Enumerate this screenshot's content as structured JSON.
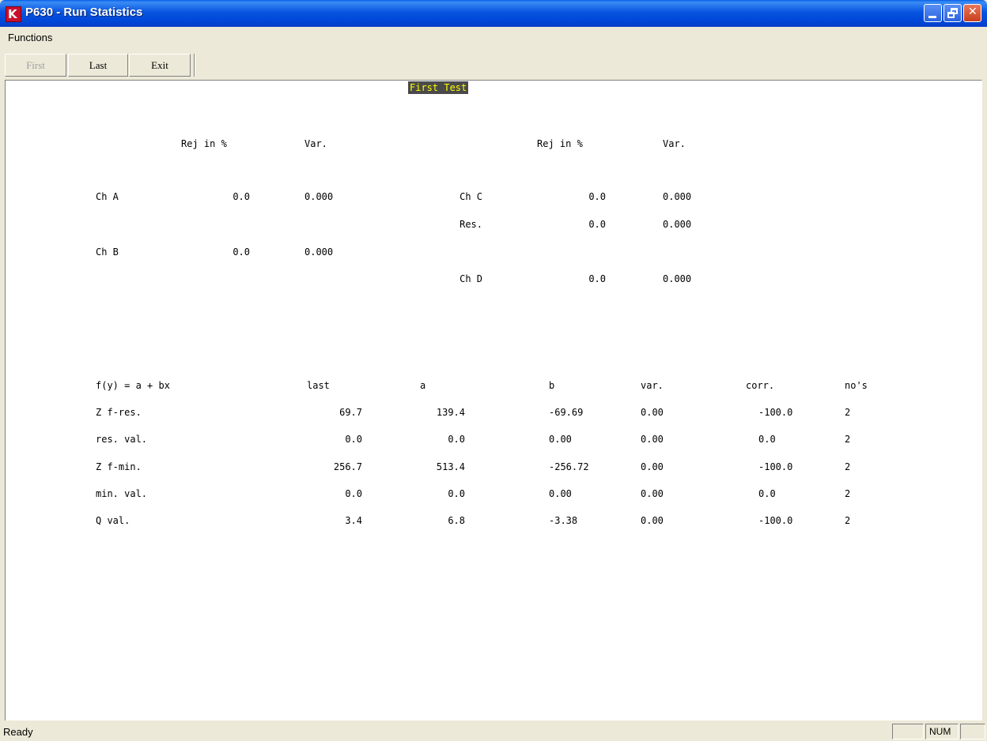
{
  "window": {
    "title": "P630 - Run Statistics",
    "app_icon": "K",
    "controls": {
      "minimize": "minimize-icon",
      "restore": "restore-icon",
      "close": "close-icon"
    }
  },
  "menu": [
    "Functions"
  ],
  "toolbar": {
    "first": "First",
    "last": "Last",
    "exit": "Exit"
  },
  "banner": "First Test",
  "rejection": {
    "headers": {
      "rej": "Rej in %",
      "var": "Var."
    },
    "left": [
      {
        "label": "Ch A",
        "rej": "0.0",
        "var": "0.000"
      },
      {
        "label": "Ch B",
        "rej": "0.0",
        "var": "0.000"
      }
    ],
    "right": [
      {
        "label": "Ch C",
        "rej": "0.0",
        "var": "0.000"
      },
      {
        "label": "Res.",
        "rej": "0.0",
        "var": "0.000"
      },
      {
        "label": "Ch D",
        "rej": "0.0",
        "var": "0.000"
      }
    ]
  },
  "regression": {
    "headers": [
      "f(y) = a + bx",
      "last",
      "a",
      "b",
      "var.",
      "corr.",
      "no's"
    ],
    "rows": [
      [
        "Z f-res.",
        "69.7",
        "139.4",
        "-69.69",
        "0.00",
        "-100.0",
        "2"
      ],
      [
        "res. val.",
        "0.0",
        "0.0",
        "0.00",
        "0.00",
        "0.0",
        "2"
      ],
      [
        "Z f-min.",
        "256.7",
        "513.4",
        "-256.72",
        "0.00",
        "-100.0",
        "2"
      ],
      [
        "min. val.",
        "0.0",
        "0.0",
        "0.00",
        "0.00",
        "0.0",
        "2"
      ],
      [
        "Q val.",
        "3.4",
        "6.8",
        "-3.38",
        "0.00",
        "-100.0",
        "2"
      ]
    ]
  },
  "status": {
    "text": "Ready",
    "num": "NUM"
  }
}
